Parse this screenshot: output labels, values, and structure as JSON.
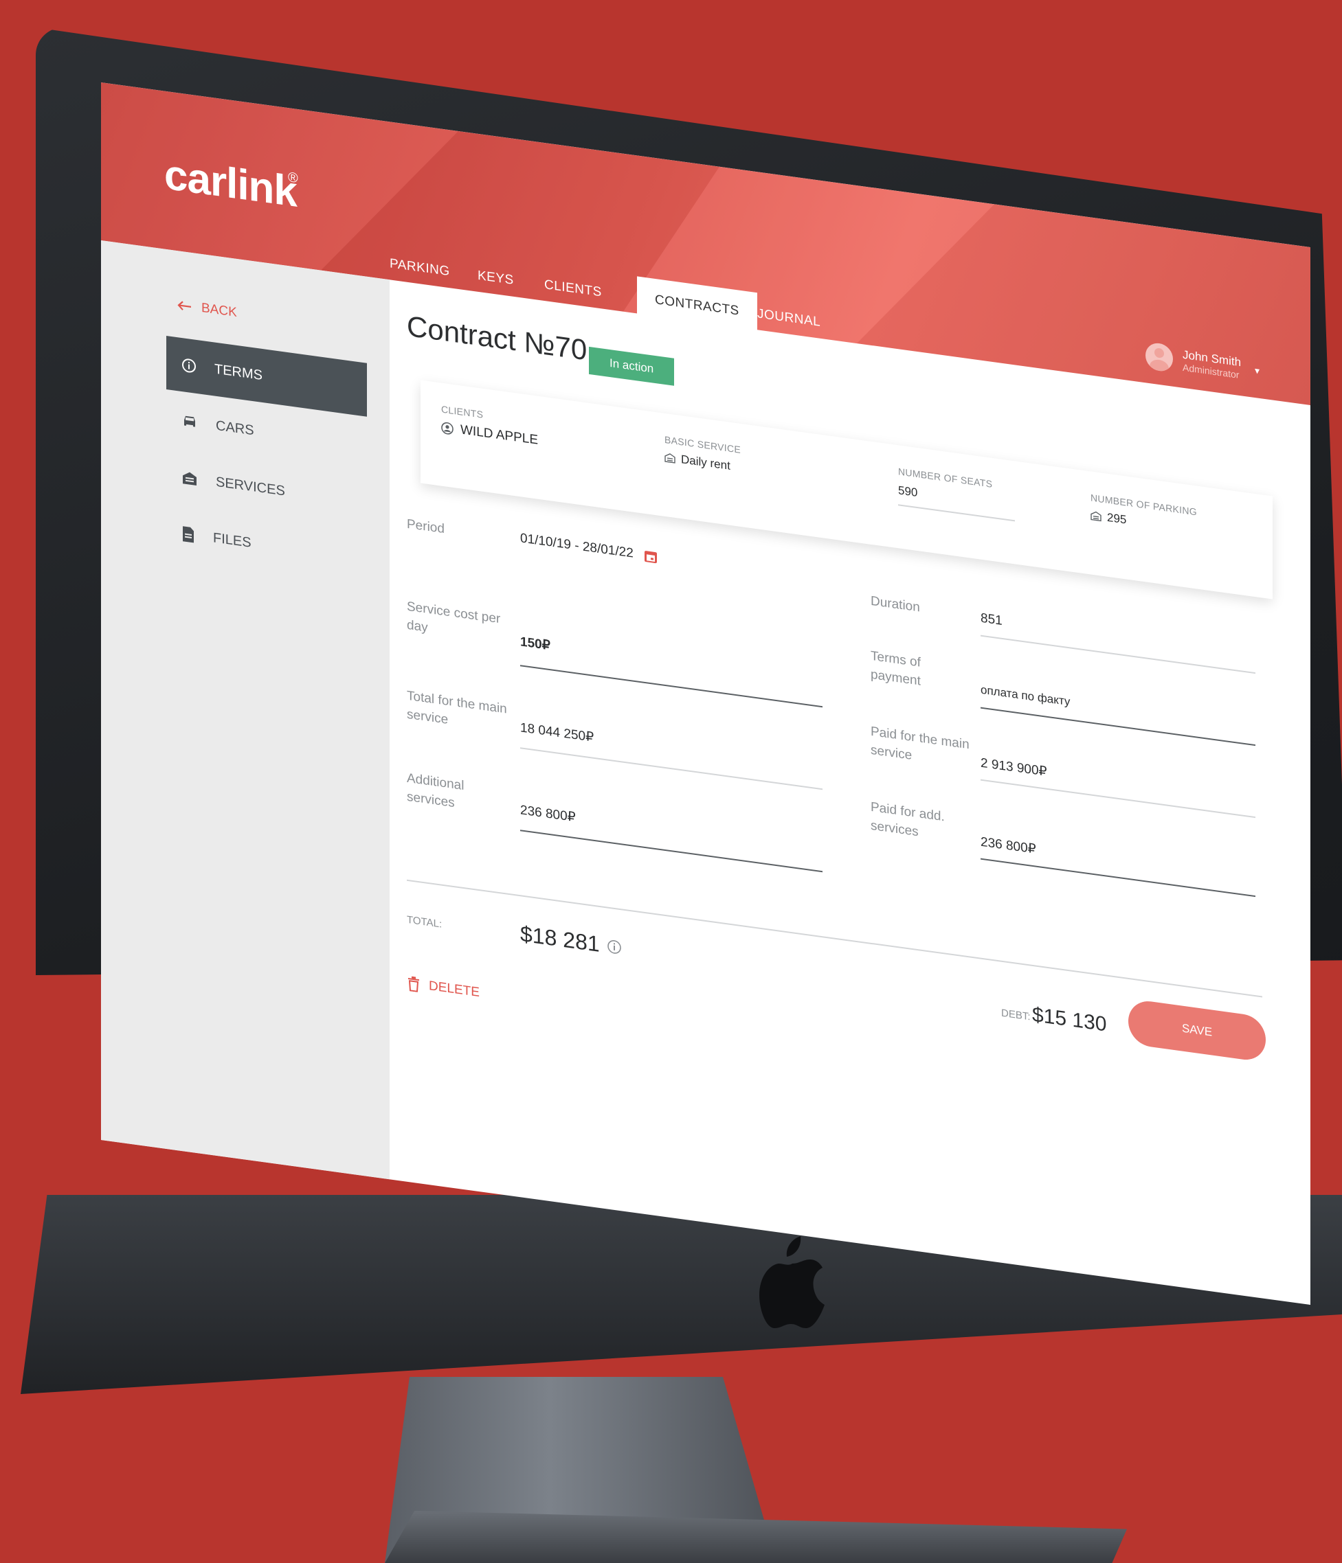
{
  "app": {
    "logo": "carlink",
    "logo_mark": "®"
  },
  "tabs": [
    {
      "label": "PARKING"
    },
    {
      "label": "KEYS"
    },
    {
      "label": "CLIENTS"
    },
    {
      "label": "CONTRACTS",
      "active": true
    },
    {
      "label": "JOURNAL"
    }
  ],
  "user": {
    "name": "John Smith",
    "role": "Administrator"
  },
  "sidebar": {
    "back_label": "BACK",
    "items": [
      {
        "label": "TERMS",
        "icon": "info-icon",
        "active": true
      },
      {
        "label": "CARS",
        "icon": "car-icon"
      },
      {
        "label": "SERVICES",
        "icon": "garage-icon"
      },
      {
        "label": "FILES",
        "icon": "file-icon"
      }
    ]
  },
  "contract": {
    "title": "Contract №70",
    "status": "In action"
  },
  "summary": {
    "clients_label": "CLIENTS",
    "clients_value": "WILD APPLE",
    "basic_service_label": "BASIC SERVICE",
    "basic_service_value": "Daily rent",
    "seats_label": "NUMBER OF SEATS",
    "seats_value": "590",
    "parking_label": "NUMBER OF PARKING",
    "parking_value": "295"
  },
  "form": {
    "period_label": "Period",
    "period_value": "01/10/19 - 28/01/22",
    "cost_label": "Service cost per day",
    "cost_value": "150₽",
    "total_main_label": "Total for the main service",
    "total_main_value": "18 044 250₽",
    "additional_label": "Additional services",
    "additional_value": "236 800₽",
    "duration_label": "Duration",
    "duration_value": "851",
    "terms_label": "Terms of payment",
    "terms_value": "оплата по факту",
    "paid_main_label": "Paid for the main service",
    "paid_main_value": "2 913 900₽",
    "paid_add_label": "Paid for add. services",
    "paid_add_value": "236 800₽"
  },
  "totals": {
    "total_label": "TOTAL:",
    "total_value": "$18 281",
    "debt_label": "DEBT:",
    "debt_value": "$15 130"
  },
  "actions": {
    "delete_label": "DELETE",
    "save_label": "SAVE"
  },
  "colors": {
    "brand": "#e35a52",
    "background": "#b8352e",
    "status": "#4caf7d"
  }
}
